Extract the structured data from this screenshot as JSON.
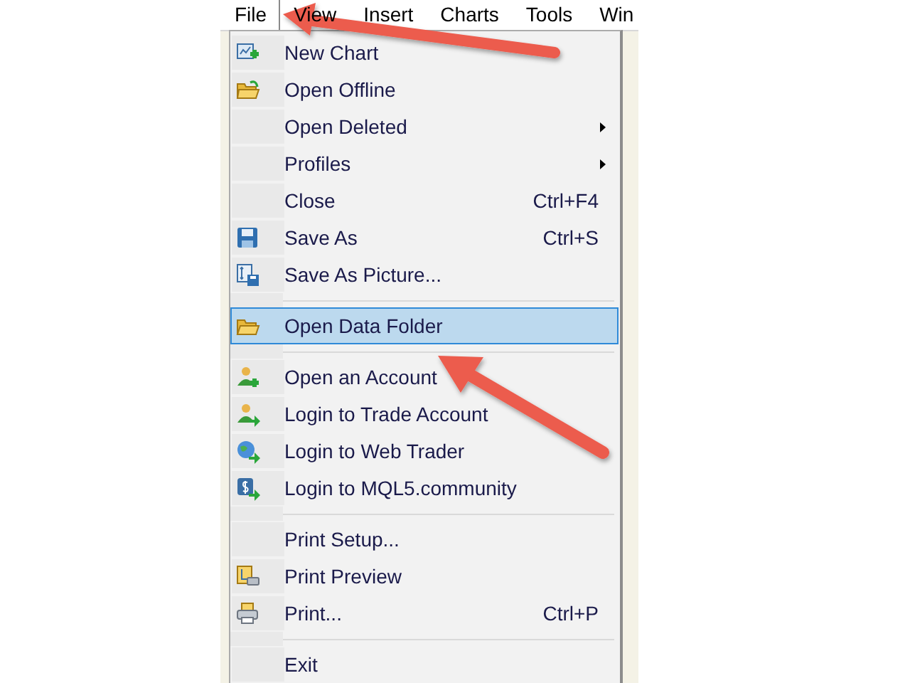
{
  "menu_bar": [
    {
      "label": "File",
      "selected": true
    },
    {
      "label": "View",
      "selected": false
    },
    {
      "label": "Insert",
      "selected": false
    },
    {
      "label": "Charts",
      "selected": false
    },
    {
      "label": "Tools",
      "selected": false
    },
    {
      "label": "Win",
      "selected": false
    }
  ],
  "file_menu": [
    {
      "kind": "item",
      "label": "New Chart",
      "selected": false
    },
    {
      "kind": "item",
      "label": "Open Offline",
      "selected": false
    },
    {
      "kind": "item",
      "label": "Open Deleted",
      "submenu": true,
      "selected": false
    },
    {
      "kind": "item",
      "label": "Profiles",
      "submenu": true,
      "selected": false
    },
    {
      "kind": "item",
      "label": "Close",
      "shortcut": "Ctrl+F4",
      "selected": false
    },
    {
      "kind": "item",
      "label": "Save As",
      "shortcut": "Ctrl+S",
      "selected": false
    },
    {
      "kind": "item",
      "label": "Save As Picture...",
      "selected": false
    },
    {
      "kind": "separator"
    },
    {
      "kind": "item",
      "label": "Open Data Folder",
      "selected": true
    },
    {
      "kind": "separator"
    },
    {
      "kind": "item",
      "label": "Open an Account",
      "selected": false
    },
    {
      "kind": "item",
      "label": "Login to Trade Account",
      "selected": false
    },
    {
      "kind": "item",
      "label": "Login to Web Trader",
      "selected": false
    },
    {
      "kind": "item",
      "label": "Login to MQL5.community",
      "selected": false
    },
    {
      "kind": "separator"
    },
    {
      "kind": "item",
      "label": "Print Setup...",
      "selected": false
    },
    {
      "kind": "item",
      "label": "Print Preview",
      "selected": false
    },
    {
      "kind": "item",
      "label": "Print...",
      "shortcut": "Ctrl+P",
      "selected": false
    },
    {
      "kind": "separator"
    },
    {
      "kind": "item",
      "label": "Exit",
      "selected": false
    }
  ]
}
